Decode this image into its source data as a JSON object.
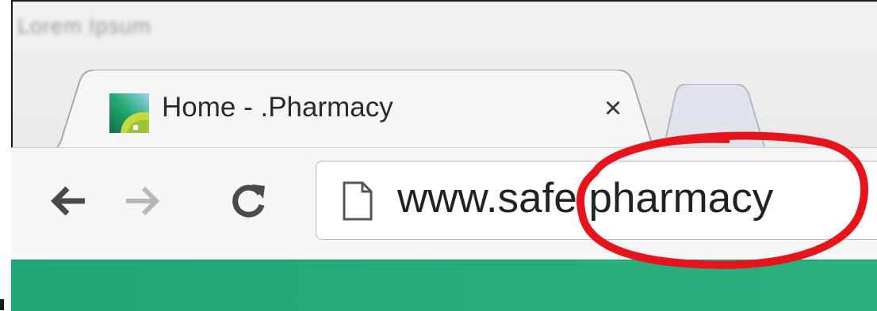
{
  "window": {
    "blurred_title": "Lorem Ipsum"
  },
  "tab": {
    "title": "Home - .Pharmacy",
    "close_glyph": "×",
    "favicon": "pharmacy-logo-icon"
  },
  "toolbar": {
    "back_icon": "arrow-left-icon",
    "forward_icon": "arrow-right-icon",
    "reload_icon": "reload-icon"
  },
  "address_bar": {
    "url": "www.safe.pharmacy",
    "page_icon": "page-icon"
  },
  "colors": {
    "site_green": "#2aae7b",
    "highlight_circle": "#e8141b"
  }
}
